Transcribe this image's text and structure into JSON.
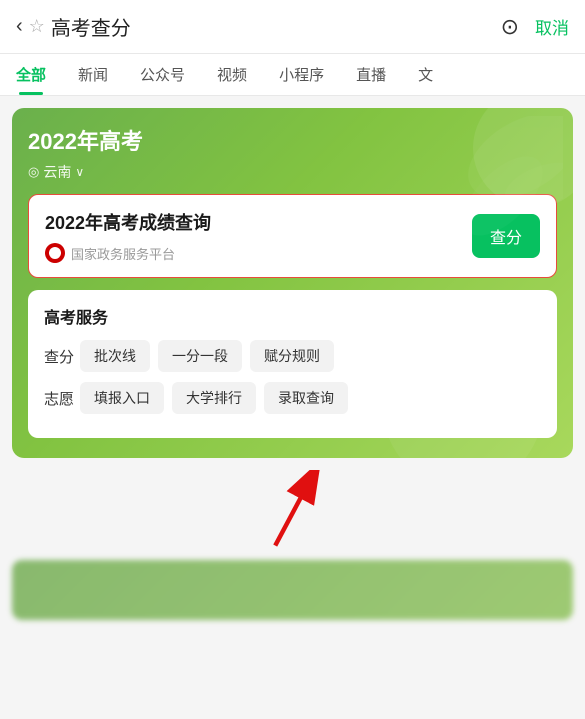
{
  "topBar": {
    "backLabel": "‹",
    "starLabel": "☆",
    "title": "高考查分",
    "cameraLabel": "⊙",
    "cancelLabel": "取消"
  },
  "tabs": [
    {
      "id": "all",
      "label": "全部",
      "active": true
    },
    {
      "id": "news",
      "label": "新闻",
      "active": false
    },
    {
      "id": "official",
      "label": "公众号",
      "active": false
    },
    {
      "id": "video",
      "label": "视频",
      "active": false
    },
    {
      "id": "mini",
      "label": "小程序",
      "active": false
    },
    {
      "id": "live",
      "label": "直播",
      "active": false
    },
    {
      "id": "text",
      "label": "文",
      "active": false
    }
  ],
  "banner": {
    "title": "2022年高考",
    "locationIcon": "◎",
    "location": "云南",
    "chevron": "∨"
  },
  "resultCard": {
    "title": "2022年高考成绩查询",
    "sourceName": "国家政务服务平台",
    "queryButtonLabel": "查分"
  },
  "services": {
    "title": "高考服务",
    "rows": [
      {
        "label": "查分",
        "tags": [
          "批次线",
          "一分一段",
          "赋分规则"
        ]
      },
      {
        "label": "志愿",
        "tags": [
          "填报入口",
          "大学排行",
          "录取查询"
        ]
      }
    ]
  },
  "arrow": {
    "color": "#e01010"
  }
}
